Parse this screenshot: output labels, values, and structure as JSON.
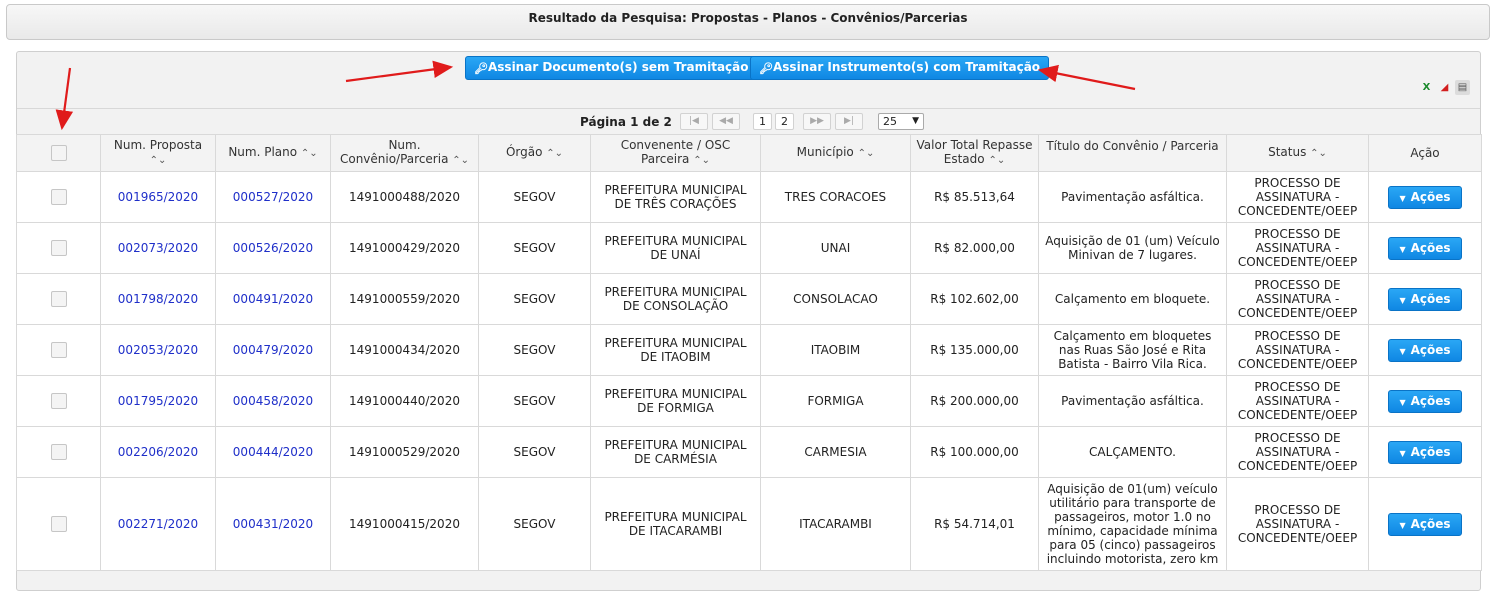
{
  "page_title": "Resultado da Pesquisa: Propostas - Planos - Convênios/Parcerias",
  "actions": {
    "sign_without": "Assinar Documento(s) sem Tramitação",
    "sign_with": "Assinar Instrumento(s) com Tramitação"
  },
  "export_icons": [
    "excel-icon",
    "pdf-icon",
    "print-icon"
  ],
  "pager": {
    "label": "Página 1 de 2",
    "first": "|◀",
    "prev": "◀◀",
    "pages": [
      "1",
      "2"
    ],
    "next": "▶▶",
    "last": "▶|",
    "page_size": "25"
  },
  "table": {
    "headers": {
      "proposta": "Num. Proposta",
      "plano": "Num. Plano",
      "convenio": "Num. Convênio/Parceria",
      "orgao": "Órgão",
      "convenente": "Convenente / OSC Parceira",
      "municipio": "Município",
      "valor": "Valor Total Repasse Estado",
      "titulo": "Título do Convênio / Parceria",
      "status": "Status",
      "acao": "Ação"
    },
    "sort_glyph": "⌃⌄",
    "action_label": "Ações",
    "rows": [
      {
        "proposta": "001965/2020",
        "plano": "000527/2020",
        "convenio": "1491000488/2020",
        "orgao": "SEGOV",
        "convenente": "PREFEITURA MUNICIPAL DE TRÊS CORAÇÕES",
        "municipio": "TRES CORACOES",
        "valor": "R$ 85.513,64",
        "titulo": "Pavimentação asfáltica.",
        "status": "PROCESSO DE ASSINATURA - CONCEDENTE/OEEP"
      },
      {
        "proposta": "002073/2020",
        "plano": "000526/2020",
        "convenio": "1491000429/2020",
        "orgao": "SEGOV",
        "convenente": "PREFEITURA MUNICIPAL DE UNAÍ",
        "municipio": "UNAI",
        "valor": "R$ 82.000,00",
        "titulo": "Aquisição de 01 (um) Veículo Minivan de 7 lugares.",
        "status": "PROCESSO DE ASSINATURA - CONCEDENTE/OEEP"
      },
      {
        "proposta": "001798/2020",
        "plano": "000491/2020",
        "convenio": "1491000559/2020",
        "orgao": "SEGOV",
        "convenente": "PREFEITURA MUNICIPAL DE CONSOLAÇÃO",
        "municipio": "CONSOLACAO",
        "valor": "R$ 102.602,00",
        "titulo": "Calçamento em bloquete.",
        "status": "PROCESSO DE ASSINATURA - CONCEDENTE/OEEP"
      },
      {
        "proposta": "002053/2020",
        "plano": "000479/2020",
        "convenio": "1491000434/2020",
        "orgao": "SEGOV",
        "convenente": "PREFEITURA MUNICIPAL DE ITAOBIM",
        "municipio": "ITAOBIM",
        "valor": "R$ 135.000,00",
        "titulo": "Calçamento em bloquetes nas Ruas São José e Rita Batista - Bairro Vila Rica.",
        "status": "PROCESSO DE ASSINATURA - CONCEDENTE/OEEP"
      },
      {
        "proposta": "001795/2020",
        "plano": "000458/2020",
        "convenio": "1491000440/2020",
        "orgao": "SEGOV",
        "convenente": "PREFEITURA MUNICIPAL DE FORMIGA",
        "municipio": "FORMIGA",
        "valor": "R$ 200.000,00",
        "titulo": "Pavimentação asfáltica.",
        "status": "PROCESSO DE ASSINATURA - CONCEDENTE/OEEP"
      },
      {
        "proposta": "002206/2020",
        "plano": "000444/2020",
        "convenio": "1491000529/2020",
        "orgao": "SEGOV",
        "convenente": "PREFEITURA MUNICIPAL DE CARMÉSIA",
        "municipio": "CARMESIA",
        "valor": "R$ 100.000,00",
        "titulo": "CALÇAMENTO.",
        "status": "PROCESSO DE ASSINATURA - CONCEDENTE/OEEP"
      },
      {
        "proposta": "002271/2020",
        "plano": "000431/2020",
        "convenio": "1491000415/2020",
        "orgao": "SEGOV",
        "convenente": "PREFEITURA MUNICIPAL DE ITACARAMBI",
        "municipio": "ITACARAMBI",
        "valor": "R$ 54.714,01",
        "titulo": "Aquisição de 01(um) veículo utilitário para transporte de passageiros, motor 1.0 no mínimo, capacidade mínima para 05 (cinco) passageiros incluindo motorista, zero km",
        "status": "PROCESSO DE ASSINATURA - CONCEDENTE/OEEP"
      }
    ]
  },
  "colors": {
    "accent_button": "#1794ea",
    "link": "#1f2fc9",
    "annotation_arrow": "#e01b1b"
  }
}
